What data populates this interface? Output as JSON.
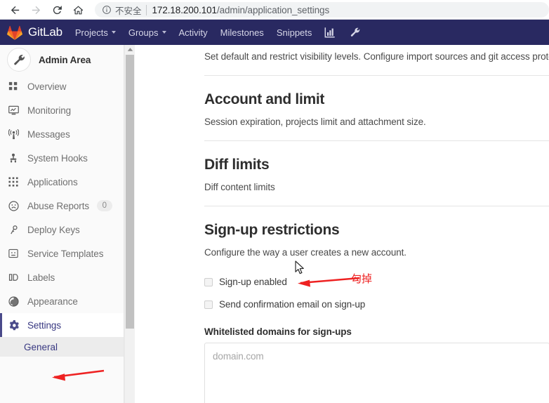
{
  "browser": {
    "back_title": "Back",
    "forward_title": "Forward",
    "reload_title": "Reload",
    "home_title": "Home",
    "security_label": "不安全",
    "url_host": "172.18.200.101",
    "url_path": "/admin/application_settings",
    "info_icon": "info-circle-icon",
    "back_icon": "arrow-left-icon",
    "forward_icon": "arrow-right-icon",
    "reload_icon": "reload-icon",
    "home_icon": "home-icon"
  },
  "navbar": {
    "brand": "GitLab",
    "brand_icon": "gitlab-fox-logo",
    "bg_color": "#292961",
    "items": [
      {
        "label": "Projects",
        "has_caret": true
      },
      {
        "label": "Groups",
        "has_caret": true
      },
      {
        "label": "Activity",
        "has_caret": false
      },
      {
        "label": "Milestones",
        "has_caret": false
      },
      {
        "label": "Snippets",
        "has_caret": false
      }
    ],
    "icons": [
      {
        "name": "chart-icon"
      },
      {
        "name": "wrench-icon"
      }
    ]
  },
  "sidebar": {
    "header": {
      "title": "Admin Area",
      "avatar_icon": "wrench-icon"
    },
    "items": [
      {
        "label": "Overview",
        "icon": "grid-overview-icon",
        "active": false,
        "badge": null
      },
      {
        "label": "Monitoring",
        "icon": "monitor-icon",
        "active": false,
        "badge": null
      },
      {
        "label": "Messages",
        "icon": "broadcast-tower-icon",
        "active": false,
        "badge": null
      },
      {
        "label": "System Hooks",
        "icon": "hook-icon",
        "active": false,
        "badge": null
      },
      {
        "label": "Applications",
        "icon": "applications-grid-icon",
        "active": false,
        "badge": null
      },
      {
        "label": "Abuse Reports",
        "icon": "frowny-face-icon",
        "active": false,
        "badge": "0"
      },
      {
        "label": "Deploy Keys",
        "icon": "key-icon",
        "active": false,
        "badge": null
      },
      {
        "label": "Service Templates",
        "icon": "template-icon",
        "active": false,
        "badge": null
      },
      {
        "label": "Labels",
        "icon": "labels-icon",
        "active": false,
        "badge": null
      },
      {
        "label": "Appearance",
        "icon": "palette-icon",
        "active": false,
        "badge": null
      },
      {
        "label": "Settings",
        "icon": "gear-icon",
        "active": true,
        "badge": null
      }
    ],
    "sub_item": {
      "label": "General",
      "active": true
    },
    "scrollbar": {
      "up_arrow_icon": "caret-up-icon"
    }
  },
  "content": {
    "visibility_desc": "Set default and restrict visibility levels. Configure import sources and git access protocol.",
    "sections": [
      {
        "title": "Account and limit",
        "desc": "Session expiration, projects limit and attachment size."
      },
      {
        "title": "Diff limits",
        "desc": "Diff content limits"
      },
      {
        "title": "Sign-up restrictions",
        "desc": "Configure the way a user creates a new account."
      }
    ],
    "checkboxes": [
      {
        "label": "Sign-up enabled",
        "checked": false
      },
      {
        "label": "Send confirmation email on sign-up",
        "checked": false
      }
    ],
    "whitelist": {
      "label": "Whitelisted domains for sign-ups",
      "placeholder": "domain.com",
      "value": ""
    }
  },
  "annotations": {
    "arrow_color": "#ee2222",
    "note_checkbox": "勾掉",
    "cursor_icon": "mouse-pointer-icon",
    "arrow_settings_name": "red-arrow-to-settings",
    "arrow_checkbox_name": "red-arrow-to-signup-checkbox"
  }
}
